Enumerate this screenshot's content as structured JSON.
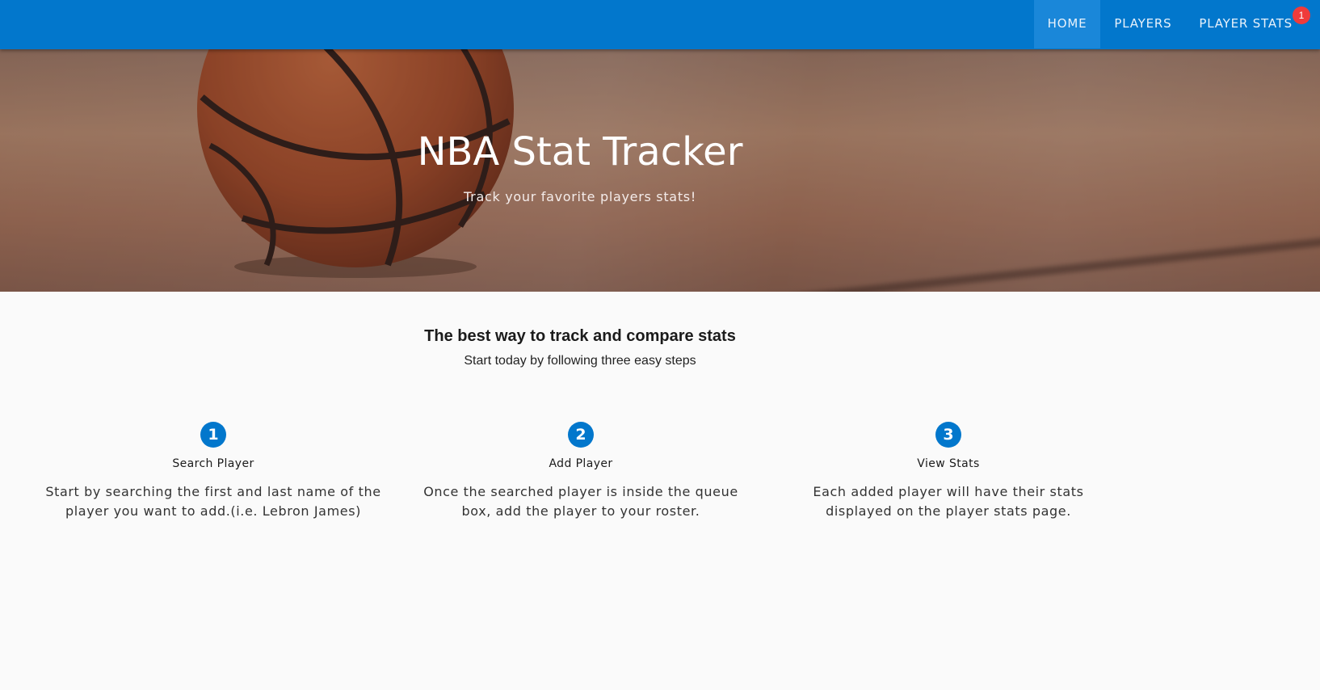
{
  "nav": {
    "links": [
      {
        "label": "HOME",
        "active": true
      },
      {
        "label": "PLAYERS",
        "active": false
      },
      {
        "label": "PLAYER STATS",
        "active": false,
        "badge": "1"
      }
    ],
    "brand_color": "#0277cc"
  },
  "hero": {
    "title": "NBA Stat Tracker",
    "subtitle": "Track your favorite players stats!",
    "image": "basketball-on-court"
  },
  "intro": {
    "heading": "The best way to track and compare stats",
    "subheading": "Start today by following three easy steps"
  },
  "steps": [
    {
      "number": "1",
      "title": "Search Player",
      "description": "Start by searching the first and last name of the player you want to add.(i.e. Lebron James)"
    },
    {
      "number": "2",
      "title": "Add Player",
      "description": "Once the searched player is inside the queue box, add the player to your roster."
    },
    {
      "number": "3",
      "title": "View Stats",
      "description": "Each added player will have their stats displayed on the player stats page."
    }
  ]
}
